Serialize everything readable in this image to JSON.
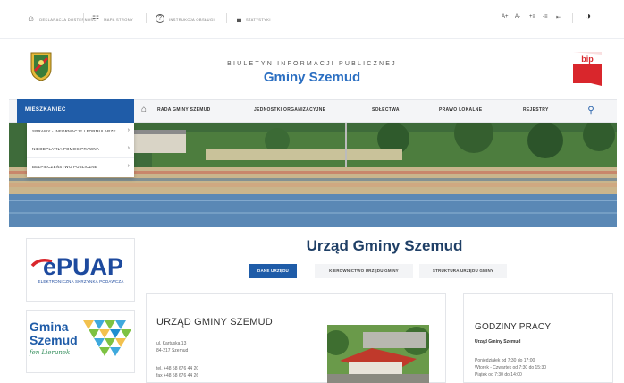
{
  "colors": {
    "accent": "#1f5ca8",
    "title": "#2b6fc2",
    "bip_red": "#d9262c",
    "epuap_red": "#d9262c"
  },
  "utility": [
    {
      "icon": "accessibility-icon",
      "glyph": "☺",
      "label": "DEKLARACJA DOSTĘPNOŚCI"
    },
    {
      "icon": "sitemap-icon",
      "glyph": "☷",
      "label": "MAPA STRONY"
    },
    {
      "icon": "help-icon",
      "glyph": "?",
      "label": "INSTRUKCJA OBSŁUGI"
    },
    {
      "icon": "stats-icon",
      "glyph": "▄",
      "label": "STATYSTYKI"
    }
  ],
  "accessibility": {
    "font_larger": "A+",
    "font_smaller": "A-",
    "spacing_1": "+≡",
    "spacing_2": "-≡",
    "spacing_3": "⇤"
  },
  "header": {
    "subtitle": "BIULETYN INFORMACJI PUBLICZNEJ",
    "title": "Gminy Szemud",
    "bip_label": "bip"
  },
  "nav": {
    "active": "MIESZKANIEC",
    "items": [
      "RADA GMINY SZEMUD",
      "JEDNOSTKI ORGANIZACYJNE",
      "SOŁECTWA",
      "PRAWO LOKALNE",
      "REJESTRY"
    ]
  },
  "dropdown": [
    "SPRAWY - INFORMACJE I FORMULARZE",
    "NIEODPŁATNA POMOC PRAWNA",
    "BEZPIECZEŃSTWO PUBLICZNE"
  ],
  "epuap": {
    "logo": "ePUAP",
    "sub": "ELEKTRONICZNA SKRZYNKA PODAWCZA"
  },
  "gmina": {
    "line1": "Gmina",
    "line2": "Szemud",
    "tagline": "fen Lierunek"
  },
  "main": {
    "title": "Urząd Gminy Szemud",
    "tabs": [
      "DANE URZĘDU",
      "KIEROWNICTWO URZĘDU GMINY",
      "STRUKTURA URZĘDU GMINY"
    ]
  },
  "office": {
    "name": "URZĄD GMINY SZEMUD",
    "street": "ul. Kartuska 13",
    "postal": "84-217 Szemud",
    "phone": "tel. +48 58 676 44 20",
    "fax": "fax +48 58 676 44 26"
  },
  "hours": {
    "title": "GODZINY PRACY",
    "subtitle": "Urząd Gminy Szemud",
    "lines": [
      "Poniedziałek od 7:30 do 17:00",
      "Wtorek - Czwartek od 7:30 do 15:30",
      "Piątek od 7:30 do 14:00"
    ]
  }
}
